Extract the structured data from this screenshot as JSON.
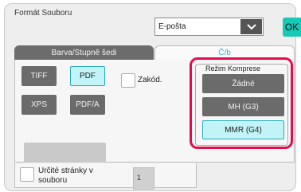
{
  "header": {
    "title": "Formát Souboru",
    "destination": "E-pošta",
    "ok_label": "OK"
  },
  "tabs": [
    {
      "label": "Barva/Stupně šedi",
      "active": false
    },
    {
      "label": "Č/b",
      "active": true
    }
  ],
  "formats": [
    {
      "label": "TIFF",
      "selected": false
    },
    {
      "label": "PDF",
      "selected": true
    },
    {
      "label": "XPS",
      "selected": false
    },
    {
      "label": "PDF/A",
      "selected": false
    }
  ],
  "encrypt_label": "Zakód.",
  "compression": {
    "label": "Režim Komprese",
    "options": [
      {
        "label": "Žádné",
        "selected": false
      },
      {
        "label": "MH (G3)",
        "selected": false
      },
      {
        "label": "MMR (G4)",
        "selected": true
      }
    ]
  },
  "pages": {
    "label": "Určité stránky v souboru",
    "value": "1"
  },
  "colors": {
    "accent": "#17c9b6",
    "highlight": "#e30d4d",
    "selected_bg": "#c2f3f6"
  }
}
